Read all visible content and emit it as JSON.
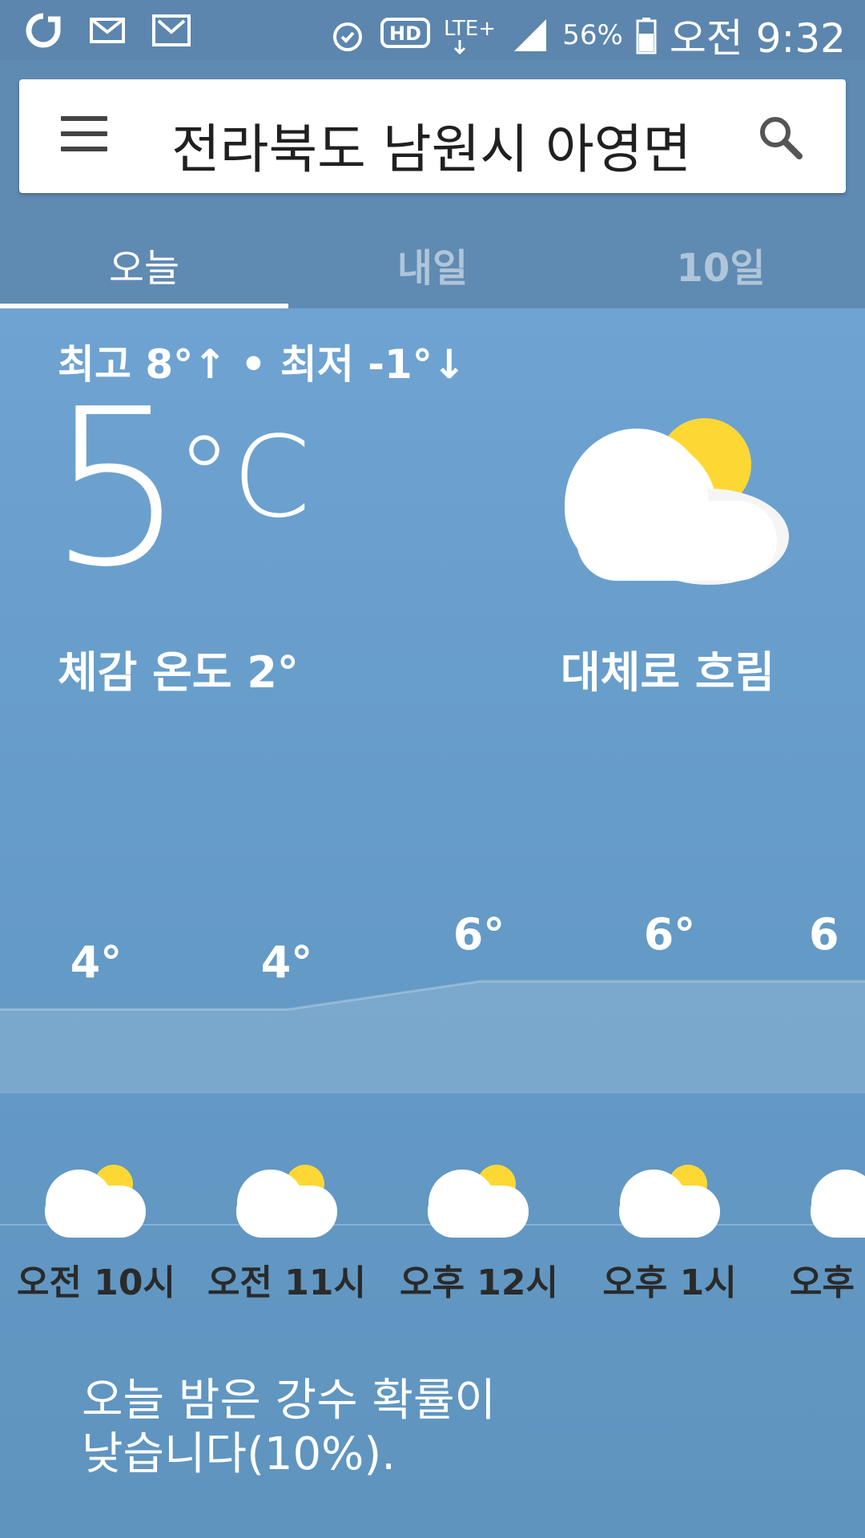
{
  "status_bar": {
    "battery": "56%",
    "time": "오전 9:32",
    "network": "LTE+",
    "hd": "HD"
  },
  "header": {
    "location": "전라북도 남원시 아영면",
    "tabs": [
      "오늘",
      "내일",
      "10일"
    ],
    "active_tab": 0
  },
  "today": {
    "hilo": "최고 8°↑ • 최저 -1°↓",
    "temperature": "5",
    "unit": "°C",
    "feels_like": "체감 온도 2°",
    "condition": "대체로 흐림",
    "condition_icon": "partly-cloudy-icon"
  },
  "hourly": [
    {
      "label": "오전 10시",
      "temp": "4°",
      "icon": "partly-cloudy-icon"
    },
    {
      "label": "오전 11시",
      "temp": "4°",
      "icon": "partly-cloudy-icon"
    },
    {
      "label": "오후 12시",
      "temp": "6°",
      "icon": "partly-cloudy-icon"
    },
    {
      "label": "오후 1시",
      "temp": "6°",
      "icon": "partly-cloudy-icon"
    },
    {
      "label": "오후",
      "temp": "6",
      "icon": "partly-cloudy-icon"
    }
  ],
  "summary_lines": [
    "오늘 밤은 강수 확률이",
    "낮습니다(10%)."
  ],
  "colors": {
    "status_bar": "#5C86AE",
    "header": "#5F8AB2",
    "sky": "#6A9ECB",
    "sun": "#FDD835"
  }
}
